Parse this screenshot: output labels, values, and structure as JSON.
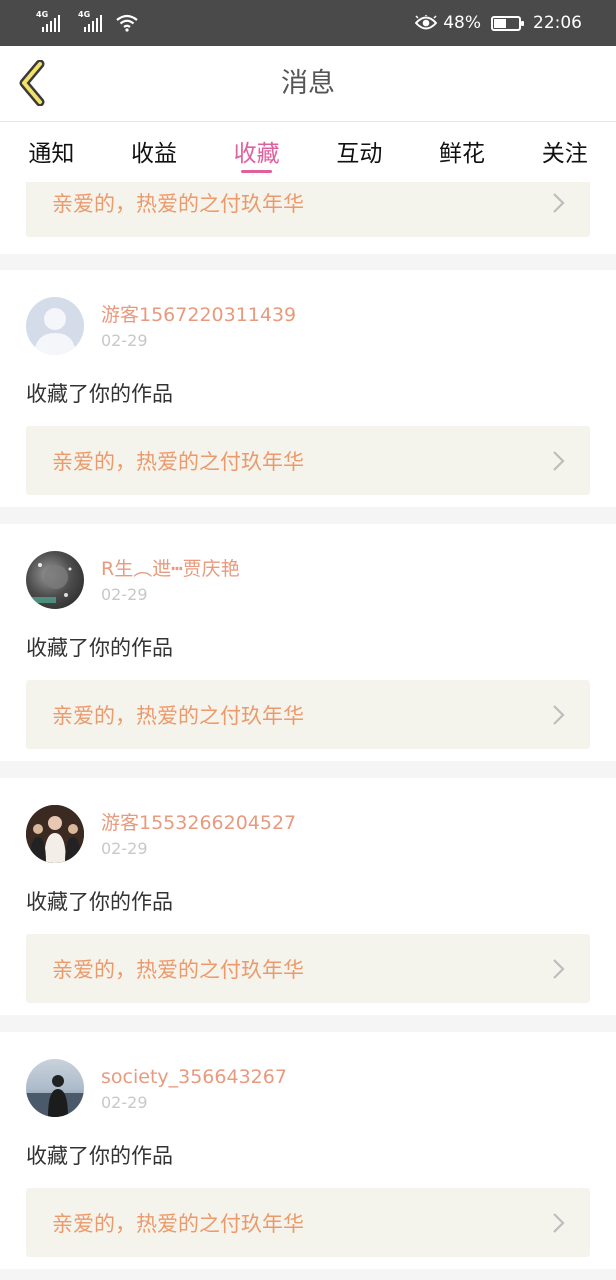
{
  "status_bar": {
    "net1": "4G",
    "net2": "4G",
    "battery_text": "48%",
    "battery_level": 0.48,
    "time": "22:06"
  },
  "header": {
    "title": "消息"
  },
  "tabs": [
    {
      "label": "通知"
    },
    {
      "label": "收益"
    },
    {
      "label": "收藏",
      "active": true
    },
    {
      "label": "互动"
    },
    {
      "label": "鲜花"
    },
    {
      "label": "关注"
    }
  ],
  "partial_item": {
    "work_title": "亲爱的，热爱的之付玖年华"
  },
  "items": [
    {
      "username": "游客1567220311439",
      "date": "02-29",
      "action": "收藏了你的作品",
      "work_title": "亲爱的，热爱的之付玖年华"
    },
    {
      "username": "R生︵迣┅贾庆艳",
      "date": "02-29",
      "action": "收藏了你的作品",
      "work_title": "亲爱的，热爱的之付玖年华"
    },
    {
      "username": "游客1553266204527",
      "date": "02-29",
      "action": "收藏了你的作品",
      "work_title": "亲爱的，热爱的之付玖年华"
    },
    {
      "username": "society_356643267",
      "date": "02-29",
      "action": "收藏了你的作品",
      "work_title": "亲爱的，热爱的之付玖年华"
    }
  ],
  "colors": {
    "accent": "#e0609e",
    "username": "#e89a7e",
    "work_title": "#ec9a6c",
    "status_bar_bg": "#4a4a4a"
  }
}
